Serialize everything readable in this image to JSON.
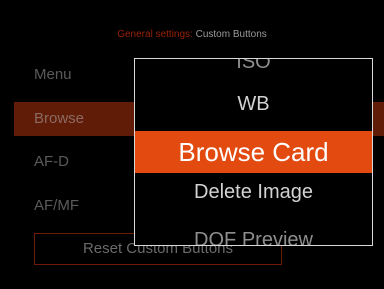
{
  "header": {
    "breadcrumb": "General settings:",
    "title": "Custom Buttons"
  },
  "menu": {
    "items": [
      {
        "label": "Menu",
        "selected": false
      },
      {
        "label": "Browse",
        "selected": true
      },
      {
        "label": "AF-D",
        "selected": false
      },
      {
        "label": "AF/MF",
        "selected": false
      }
    ],
    "reset_label": "Reset Custom Buttons"
  },
  "popup": {
    "options": [
      "ISO",
      "WB",
      "Browse Card",
      "Delete Image",
      "DOF Preview"
    ],
    "selected_option": "Browse Card"
  },
  "colors": {
    "accent": "#e24a10",
    "selected_row": "#611c08",
    "breadcrumb": "#9a2208"
  }
}
